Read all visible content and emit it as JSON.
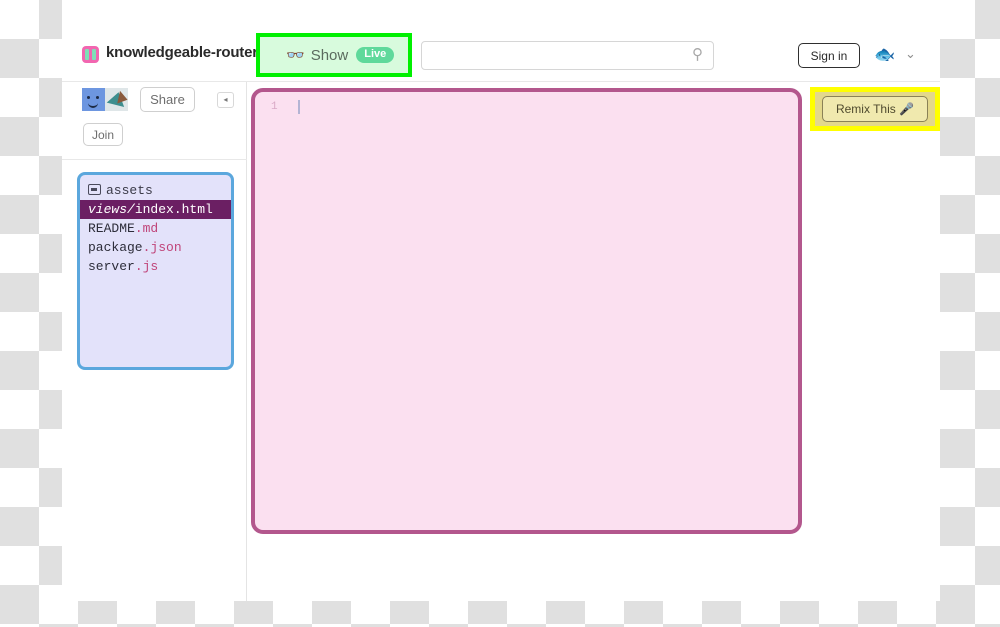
{
  "header": {
    "project_icon": "book-icon",
    "project_name": "knowledgeable-router",
    "project_chevron": "⌄",
    "show_group": {
      "glasses_icon": "👓",
      "show_label": "Show",
      "live_badge": "Live",
      "highlight_color": "#00f000",
      "highlight_fill": "#d8fbdd"
    },
    "search": {
      "value": "",
      "placeholder": "",
      "icon": "search-icon",
      "icon_glyph": "⚲"
    },
    "sign_in_label": "Sign in",
    "user_avatar_glyph": "🐟",
    "user_chevron": "⌄"
  },
  "sidebar": {
    "share_label": "Share",
    "join_label": "Join",
    "collapse_glyph": "◂",
    "avatars": [
      "blue-smiley-avatar",
      "teal-shape-avatar"
    ],
    "files": [
      {
        "kind": "folder",
        "name": "assets",
        "icon": "folder-icon",
        "selected": false
      },
      {
        "kind": "file",
        "dir": "views/",
        "base": "index",
        "ext": ".html",
        "ext_class": "ext-html",
        "selected": true
      },
      {
        "kind": "file",
        "dir": "",
        "base": "README",
        "ext": ".md",
        "ext_class": "ext-md",
        "selected": false
      },
      {
        "kind": "file",
        "dir": "",
        "base": "package",
        "ext": ".json",
        "ext_class": "ext-json",
        "selected": false
      },
      {
        "kind": "file",
        "dir": "",
        "base": "server",
        "ext": ".js",
        "ext_class": "ext-js",
        "selected": false
      }
    ],
    "panel_border_color": "#5ba7dd",
    "panel_fill_color": "#e3e2fa",
    "selected_row_color": "#6b1f63"
  },
  "editor": {
    "line_number": "1",
    "content": "",
    "border_color": "#b3578d",
    "fill_color": "#fbe0f0"
  },
  "remix": {
    "label": "Remix This 🎤",
    "highlight_color": "#ffff00",
    "inner_color": "#e3d88c"
  }
}
